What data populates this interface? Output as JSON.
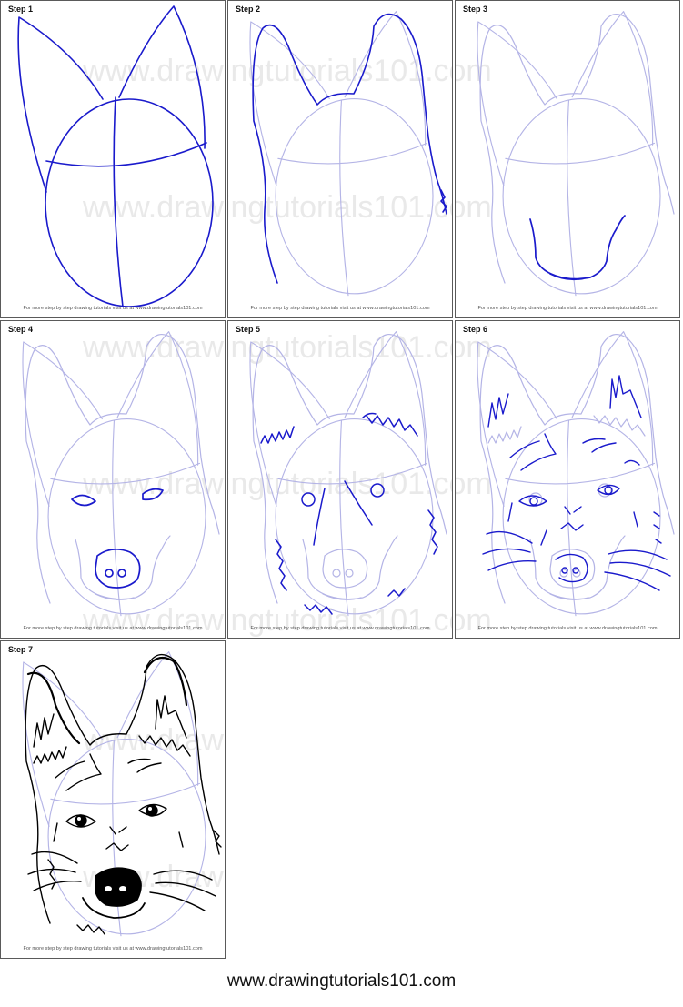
{
  "steps": [
    {
      "label": "Step 1"
    },
    {
      "label": "Step 2"
    },
    {
      "label": "Step 3"
    },
    {
      "label": "Step 4"
    },
    {
      "label": "Step 5"
    },
    {
      "label": "Step 6"
    },
    {
      "label": "Step 7"
    }
  ],
  "panel_footer": "For more step by step drawing tutorials visit us at www.drawingtutorials101.com",
  "watermark_text": "www.drawingtutorials101.com",
  "site_url": "www.drawingtutorials101.com",
  "colors": {
    "new_stroke": "#1a1acc",
    "guide_stroke": "#b4b4e6",
    "final_stroke": "#000000",
    "watermark": "#e9e9e9"
  }
}
